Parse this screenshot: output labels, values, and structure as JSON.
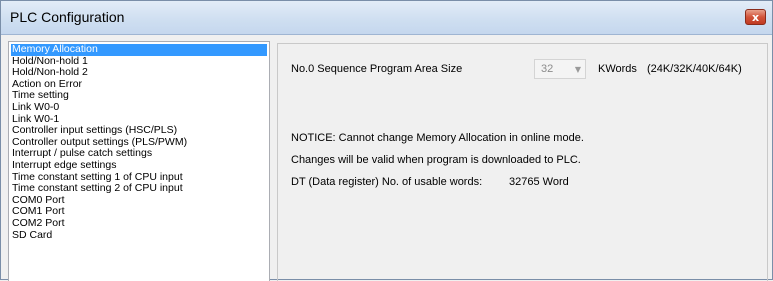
{
  "window": {
    "title": "PLC Configuration",
    "close_glyph": "x"
  },
  "list": {
    "selected_index": 0,
    "items": [
      "Memory Allocation",
      "Hold/Non-hold 1",
      "Hold/Non-hold 2",
      "Action on Error",
      "Time setting",
      "Link W0-0",
      "Link W0-1",
      "Controller input settings (HSC/PLS)",
      "Controller output settings (PLS/PWM)",
      "Interrupt / pulse catch settings",
      "Interrupt edge settings",
      "Time constant setting 1 of CPU input",
      "Time constant setting 2 of CPU input",
      "COM0 Port",
      "COM1 Port",
      "COM2 Port",
      "SD Card"
    ]
  },
  "panel": {
    "area_size_label": "No.0 Sequence Program Area Size",
    "area_size_value": "32",
    "area_size_unit": "KWords",
    "area_size_options_hint": "(24K/32K/40K/64K)",
    "notice": "NOTICE: Cannot change Memory Allocation in online mode.",
    "changes_note": "Changes will be valid when program is downloaded to PLC.",
    "dt_label": "DT (Data register) No. of usable words:",
    "dt_value": "32765 Word"
  },
  "colors": {
    "selection": "#3399ff",
    "titlebar": "#cfdff1",
    "close_button": "#d2543a"
  }
}
